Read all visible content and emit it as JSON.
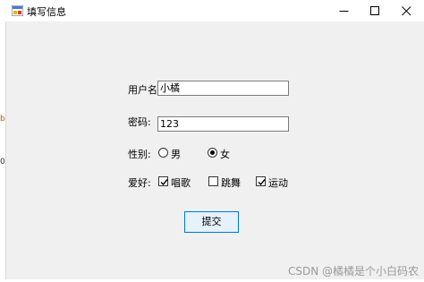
{
  "window": {
    "title": "填写信息",
    "controls": [
      "minimize",
      "maximize",
      "close"
    ]
  },
  "form": {
    "username": {
      "label": "用户名:",
      "value": "小橘"
    },
    "password": {
      "label": "密码:",
      "value": "123"
    },
    "gender": {
      "label": "性别:",
      "options": [
        {
          "label": "男",
          "selected": false
        },
        {
          "label": "女",
          "selected": true
        }
      ]
    },
    "hobby": {
      "label": "爱好:",
      "options": [
        {
          "label": "唱歌",
          "checked": true
        },
        {
          "label": "跳舞",
          "checked": false
        },
        {
          "label": "运动",
          "checked": true
        }
      ]
    },
    "submit_label": "提交"
  },
  "watermark": "CSDN @橘橘是个小白码农",
  "colors": {
    "accent": "#0078d7",
    "client_bg": "#f0f0f0",
    "button_bg": "#e5f1fb"
  }
}
